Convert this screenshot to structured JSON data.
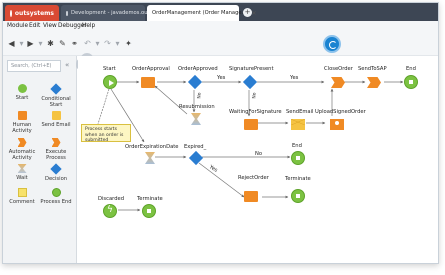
{
  "tabs": [
    {
      "label": "outsystems",
      "active": false
    },
    {
      "label": "Development - javademos.outsyst...",
      "active": false
    },
    {
      "label": "OrderManagement (Order Manage...",
      "active": true
    }
  ],
  "menu": [
    "Module",
    "Edit",
    "View",
    "Debugger",
    "Help"
  ],
  "toolbar": {
    "back_label": "◀",
    "forward_label": "▶",
    "undo_label": "↶",
    "redo_label": "↷"
  },
  "search": {
    "placeholder": "Search, (Ctrl+E)"
  },
  "collapse_label": "«",
  "tools": [
    {
      "label": "Start",
      "icon": "start-icon"
    },
    {
      "label": "Conditional Start",
      "icon": "conditional-start-icon"
    },
    {
      "label": "Human Activity",
      "icon": "human-activity-icon"
    },
    {
      "label": "Send Email",
      "icon": "send-email-icon"
    },
    {
      "label": "Automatic Activity",
      "icon": "automatic-activity-icon"
    },
    {
      "label": "Execute Process",
      "icon": "execute-process-icon"
    },
    {
      "label": "Wait",
      "icon": "wait-icon"
    },
    {
      "label": "Decision",
      "icon": "decision-icon"
    },
    {
      "label": "Comment",
      "icon": "comment-icon"
    },
    {
      "label": "Process End",
      "icon": "process-end-icon"
    }
  ],
  "flow": {
    "start": "Start",
    "order_approval": "OrderApproval",
    "order_approved": "OrderApproved",
    "signature_present": "SignaturePresent",
    "close_order": "CloseOrder",
    "send_to_sap": "SendToSAP",
    "end1": "End",
    "resubmission": "Resubmission",
    "waiting_for_signature": "WaitingForSignature",
    "send_email": "SendEmail",
    "upload_signed_order": "UploadSignedOrder",
    "order_expiration_date": "OrderExpirationDate",
    "expired": "Expired_",
    "end2": "End",
    "reject_order": "RejectOrder",
    "terminate1": "Terminate",
    "discarded": "Discarded",
    "terminate2": "Terminate",
    "yes1": "Yes",
    "yes2": "Yes",
    "no1": "No",
    "no2": "No",
    "no3": "No",
    "yes3": "Yes",
    "note": "Process starts when an order is submitted"
  },
  "colors": {
    "accent": "#d94a34",
    "start_green": "#7cc242",
    "activity_orange": "#f08a24",
    "decision_blue": "#2a7dd1"
  }
}
